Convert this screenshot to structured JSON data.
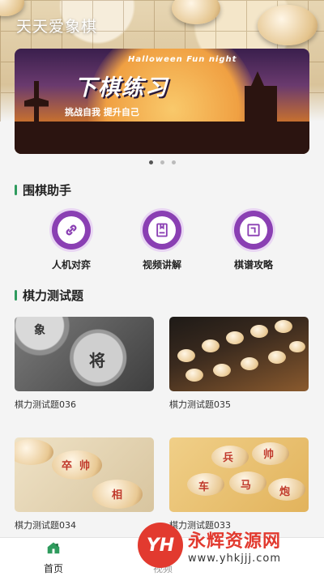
{
  "app": {
    "title": "天天爱象棋"
  },
  "banner": {
    "tagline": "Halloween Fun night",
    "title": "下棋练习",
    "subtitle": "挑战自我  提升自己",
    "pages": 3,
    "active_page": 1
  },
  "sections": {
    "assistant": {
      "title": "围棋助手"
    },
    "tests": {
      "title": "棋力测试题"
    }
  },
  "tools": [
    {
      "label": "人机对弈",
      "icon": "link-icon"
    },
    {
      "label": "视频讲解",
      "icon": "bookmark-icon"
    },
    {
      "label": "棋谱攻略",
      "icon": "frame-icon"
    }
  ],
  "cards": [
    {
      "caption": "棋力测试题036",
      "piece_text": [
        "象",
        "将"
      ]
    },
    {
      "caption": "棋力测试题035"
    },
    {
      "caption": "棋力测试题034",
      "piece_text": [
        "卒",
        "帅",
        "相"
      ]
    },
    {
      "caption": "棋力测试题033",
      "piece_text": [
        "兵",
        "帅",
        "炮",
        "车",
        "马"
      ]
    }
  ],
  "tabbar": {
    "items": [
      {
        "label": "首页",
        "icon": "home-icon",
        "active": true
      },
      {
        "label": "视频",
        "icon": "video-icon",
        "active": false
      }
    ]
  },
  "watermark": {
    "logo": "YH",
    "name": "永辉资源网",
    "url": "www.yhkjjj.com"
  },
  "colors": {
    "accent": "#2e9b5d",
    "icon_purple": "#8a3fb3",
    "watermark_red": "#e23a2f"
  }
}
